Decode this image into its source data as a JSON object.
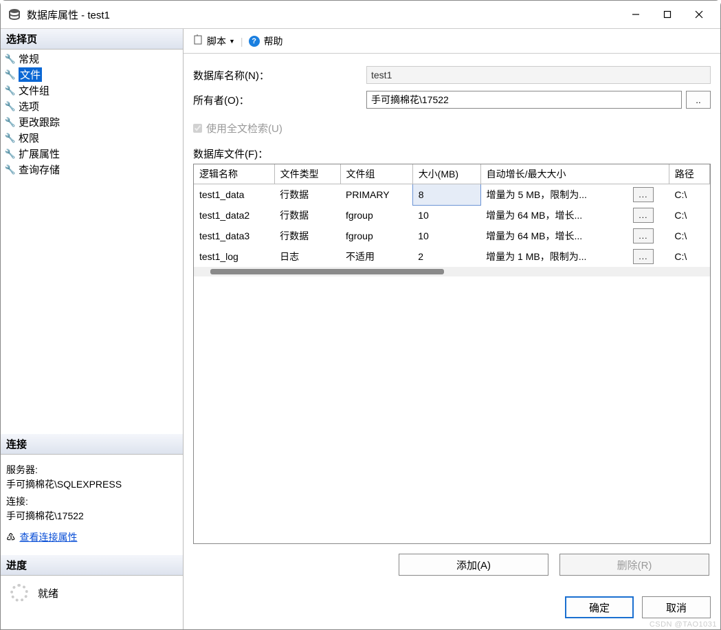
{
  "window": {
    "title": "数据库属性 - test1"
  },
  "left": {
    "select_pages": "选择页",
    "nav": [
      {
        "label": "常规"
      },
      {
        "label": "文件"
      },
      {
        "label": "文件组"
      },
      {
        "label": "选项"
      },
      {
        "label": "更改跟踪"
      },
      {
        "label": "权限"
      },
      {
        "label": "扩展属性"
      },
      {
        "label": "查询存储"
      }
    ],
    "selected_index": 1,
    "connection_header": "连接",
    "server_label": "服务器:",
    "server_value": "手可摘棉花\\SQLEXPRESS",
    "conn_label": "连接:",
    "conn_value": "手可摘棉花\\17522",
    "view_link": "查看连接属性",
    "progress_header": "进度",
    "progress_status": "就绪"
  },
  "toolbar": {
    "script": "脚本",
    "help": "帮助"
  },
  "form": {
    "db_name_label": "数据库名称(N)：",
    "db_name_value": "test1",
    "owner_label": "所有者(O)：",
    "owner_value": "手可摘棉花\\17522",
    "browse_label": "..",
    "fulltext_label": "使用全文检索(U)",
    "files_label": "数据库文件(F)："
  },
  "grid": {
    "headers": {
      "name": "逻辑名称",
      "type": "文件类型",
      "group": "文件组",
      "size": "大小(MB)",
      "growth": "自动增长/最大大小",
      "btn": "...",
      "path": "路径"
    },
    "rows": [
      {
        "name": "test1_data",
        "type": "行数据",
        "group": "PRIMARY",
        "size": "8",
        "growth": "增量为 5 MB，限制为...",
        "path": "C:\\"
      },
      {
        "name": "test1_data2",
        "type": "行数据",
        "group": "fgroup",
        "size": "10",
        "growth": "增量为 64 MB，增长...",
        "path": "C:\\"
      },
      {
        "name": "test1_data3",
        "type": "行数据",
        "group": "fgroup",
        "size": "10",
        "growth": "增量为 64 MB，增长...",
        "path": "C:\\"
      },
      {
        "name": "test1_log",
        "type": "日志",
        "group": "不适用",
        "size": "2",
        "growth": "增量为 1 MB，限制为...",
        "path": "C:\\"
      }
    ],
    "selected_row": 0
  },
  "actions": {
    "add": "添加(A)",
    "remove": "删除(R)"
  },
  "footer": {
    "ok": "确定",
    "cancel": "取消"
  },
  "watermark": "CSDN @TAO1031"
}
